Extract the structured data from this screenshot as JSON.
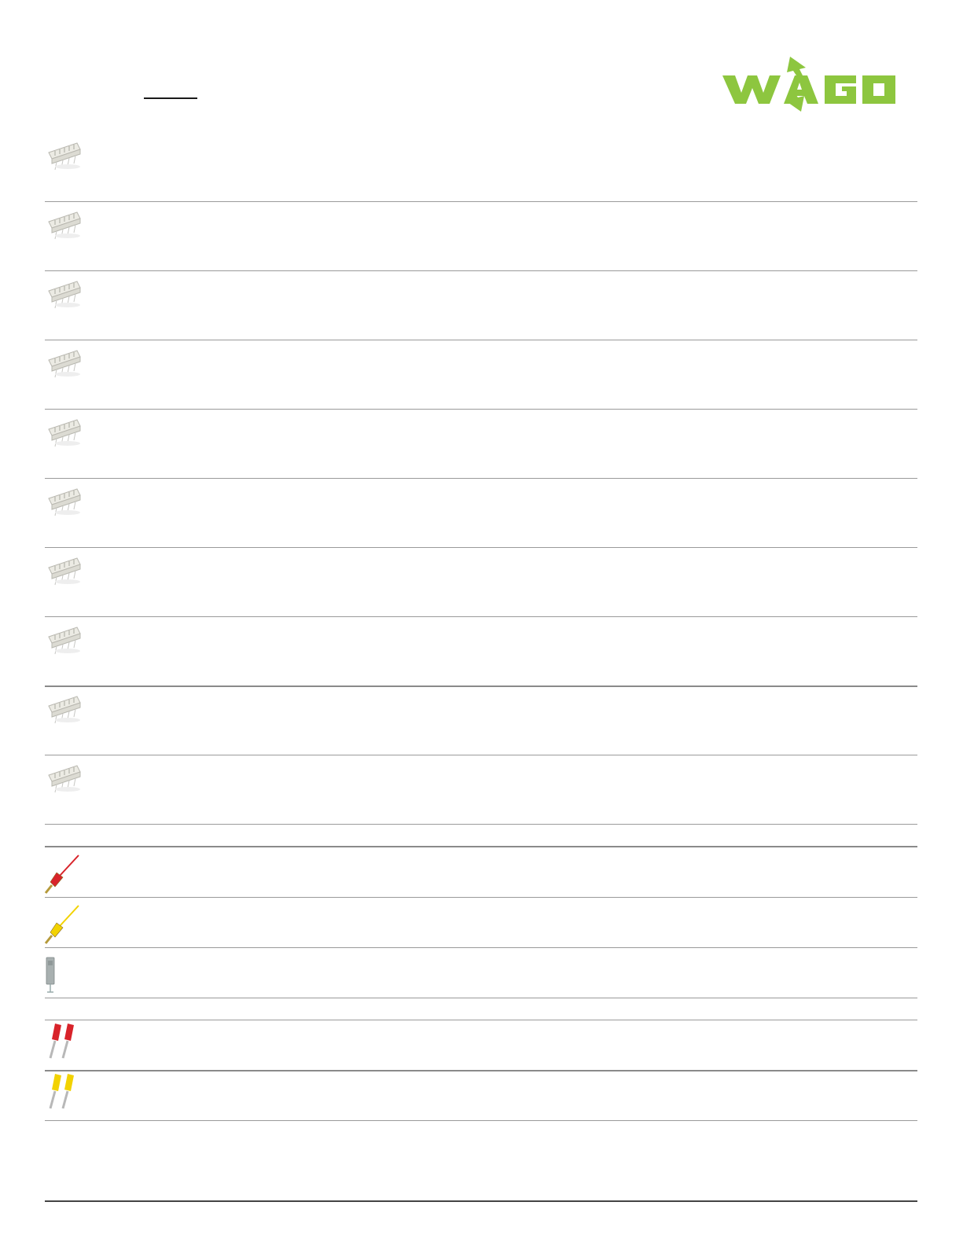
{
  "brand": {
    "logo_text": "WAGO",
    "logo_color": "#8dc63f"
  },
  "products": {
    "connectors": [
      {
        "icon": "connector-thumbnail-icon"
      },
      {
        "icon": "connector-thumbnail-icon"
      },
      {
        "icon": "connector-thumbnail-icon"
      },
      {
        "icon": "connector-thumbnail-icon"
      },
      {
        "icon": "connector-thumbnail-icon"
      },
      {
        "icon": "connector-thumbnail-icon"
      },
      {
        "icon": "connector-thumbnail-icon"
      },
      {
        "icon": "connector-thumbnail-icon"
      },
      {
        "icon": "connector-thumbnail-icon"
      },
      {
        "icon": "connector-thumbnail-icon"
      }
    ],
    "accessories": [
      {
        "icon": "red-test-plug-icon",
        "color": "#d8232a"
      },
      {
        "icon": "yellow-test-plug-icon",
        "color": "#f2d200"
      },
      {
        "icon": "gray-test-adapter-icon",
        "color": "#a8b0b0"
      },
      {
        "icon": "red-test-plug-pair-icon",
        "color": "#d8232a"
      },
      {
        "icon": "yellow-test-plug-pair-icon",
        "color": "#f2d200"
      }
    ]
  }
}
